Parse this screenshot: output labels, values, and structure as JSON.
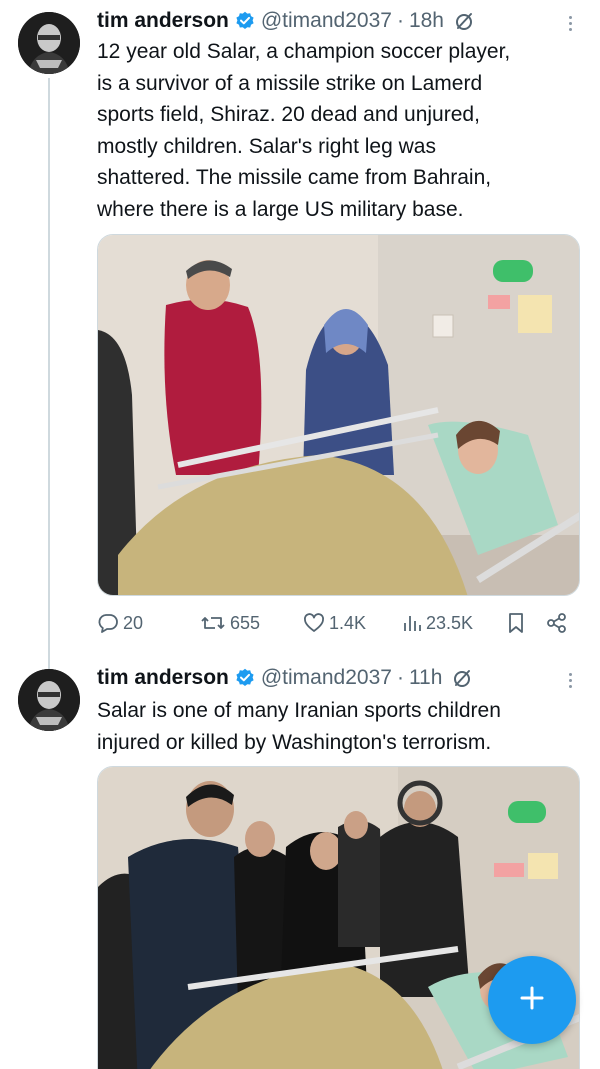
{
  "tweets": [
    {
      "name": "tim anderson",
      "handle": "@timand2037",
      "separator": "·",
      "time": "18h",
      "lines": [
        "12 year old Salar, a champion soccer player,",
        "is a survivor of a missile strike on Lamerd",
        "sports field, Shiraz. 20 dead and unjured,",
        "mostly children. Salar's  right leg was",
        "shattered. The missile came from Bahrain,",
        "where there is a large US military base."
      ],
      "stats": {
        "replies": "20",
        "reposts": "655",
        "likes": "1.4K",
        "views": "23.5K"
      }
    },
    {
      "name": "tim anderson",
      "handle": "@timand2037",
      "separator": "·",
      "time": "11h",
      "lines": [
        "Salar is one of many Iranian sports children",
        "injured or killed by Washington's terrorism."
      ]
    }
  ],
  "icons": {
    "verified": "verified-badge-icon",
    "no_badge": "circle-slash-icon",
    "more": "more-vertical-icon",
    "reply": "reply-bubble-icon",
    "repost": "repost-arrows-icon",
    "like": "heart-icon",
    "views": "bar-chart-icon",
    "bookmark": "bookmark-icon",
    "share": "share-icon",
    "compose": "plus-icon"
  },
  "colors": {
    "accent": "#1d9bf0",
    "text": "#0f1419",
    "muted": "#536471",
    "thread": "#cfd9de"
  }
}
